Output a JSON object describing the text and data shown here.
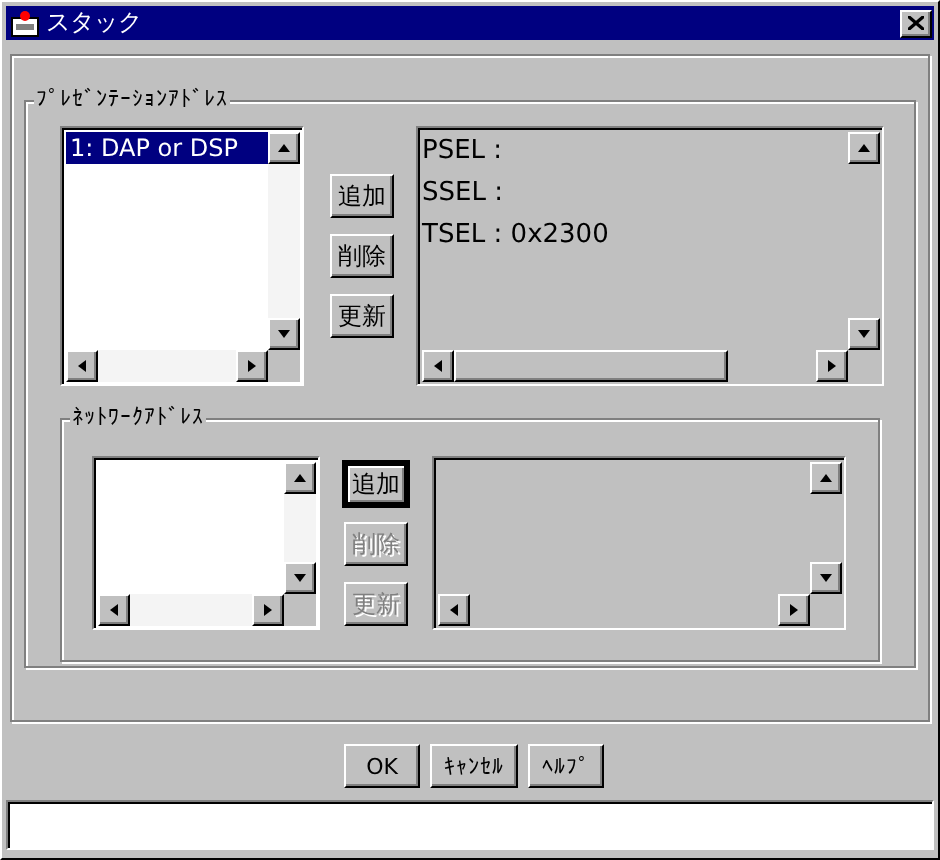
{
  "window": {
    "title": "スタック"
  },
  "presentation_group": {
    "title": "ﾌﾟﾚｾﾞﾝﾃｰｼｮﾝｱﾄﾞﾚｽ",
    "list": {
      "items": [
        {
          "label": "1: DAP or DSP",
          "selected": true
        }
      ]
    },
    "buttons": [
      {
        "label": "追加",
        "disabled": false,
        "focused": false
      },
      {
        "label": "削除",
        "disabled": false,
        "focused": false
      },
      {
        "label": "更新",
        "disabled": false,
        "focused": false
      }
    ],
    "details": [
      "PSEL :",
      "SSEL :",
      "TSEL : 0x2300"
    ]
  },
  "network_group": {
    "title": "ﾈｯﾄﾜｰｸｱﾄﾞﾚｽ",
    "buttons": [
      {
        "label": "追加",
        "disabled": false,
        "focused": true
      },
      {
        "label": "削除",
        "disabled": true,
        "focused": false
      },
      {
        "label": "更新",
        "disabled": true,
        "focused": false
      }
    ]
  },
  "dialog_buttons": [
    "OK",
    "ｷｬﾝｾﾙ",
    "ﾍﾙﾌﾟ"
  ]
}
